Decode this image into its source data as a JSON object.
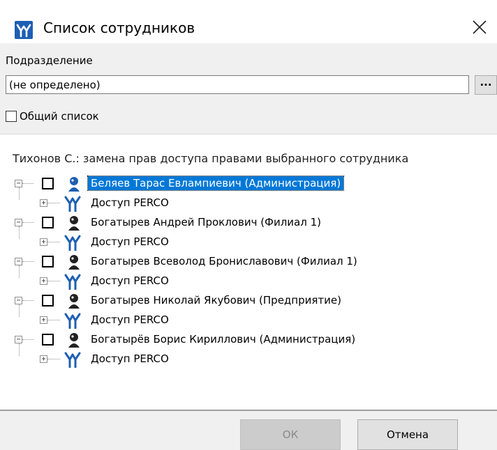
{
  "window": {
    "title": "Список сотрудников",
    "icon": "perco-logo-icon",
    "close_label": "✕"
  },
  "filter": {
    "division_label": "Подразделение",
    "division_value": "(не определено)",
    "browse_label": "...",
    "common_list_label": "Общий список",
    "common_list_checked": false
  },
  "list_caption": "Тихонов С.: замена прав доступа правами выбранного сотрудника",
  "tree": {
    "access_label": "Доступ PERCO",
    "employees": [
      {
        "name": "Беляев Тарас Евлампиевич (Администрация)",
        "selected": true,
        "checked": false
      },
      {
        "name": "Богатырев Андрей Проклович (Филиал 1)",
        "selected": false,
        "checked": false
      },
      {
        "name": "Богатырев Всеволод Брониславович (Филиал 1)",
        "selected": false,
        "checked": false
      },
      {
        "name": "Богатырев Николай Якубович (Предприятие)",
        "selected": false,
        "checked": false
      },
      {
        "name": "Богатырёв Борис Кириллович (Администрация)",
        "selected": false,
        "checked": false
      }
    ]
  },
  "buttons": {
    "ok_label": "ОК",
    "cancel_label": "Отмена"
  },
  "colors": {
    "selection": "#0078d7",
    "perco_blue": "#1e5fb3",
    "panel_bg": "#f0f0f0"
  }
}
